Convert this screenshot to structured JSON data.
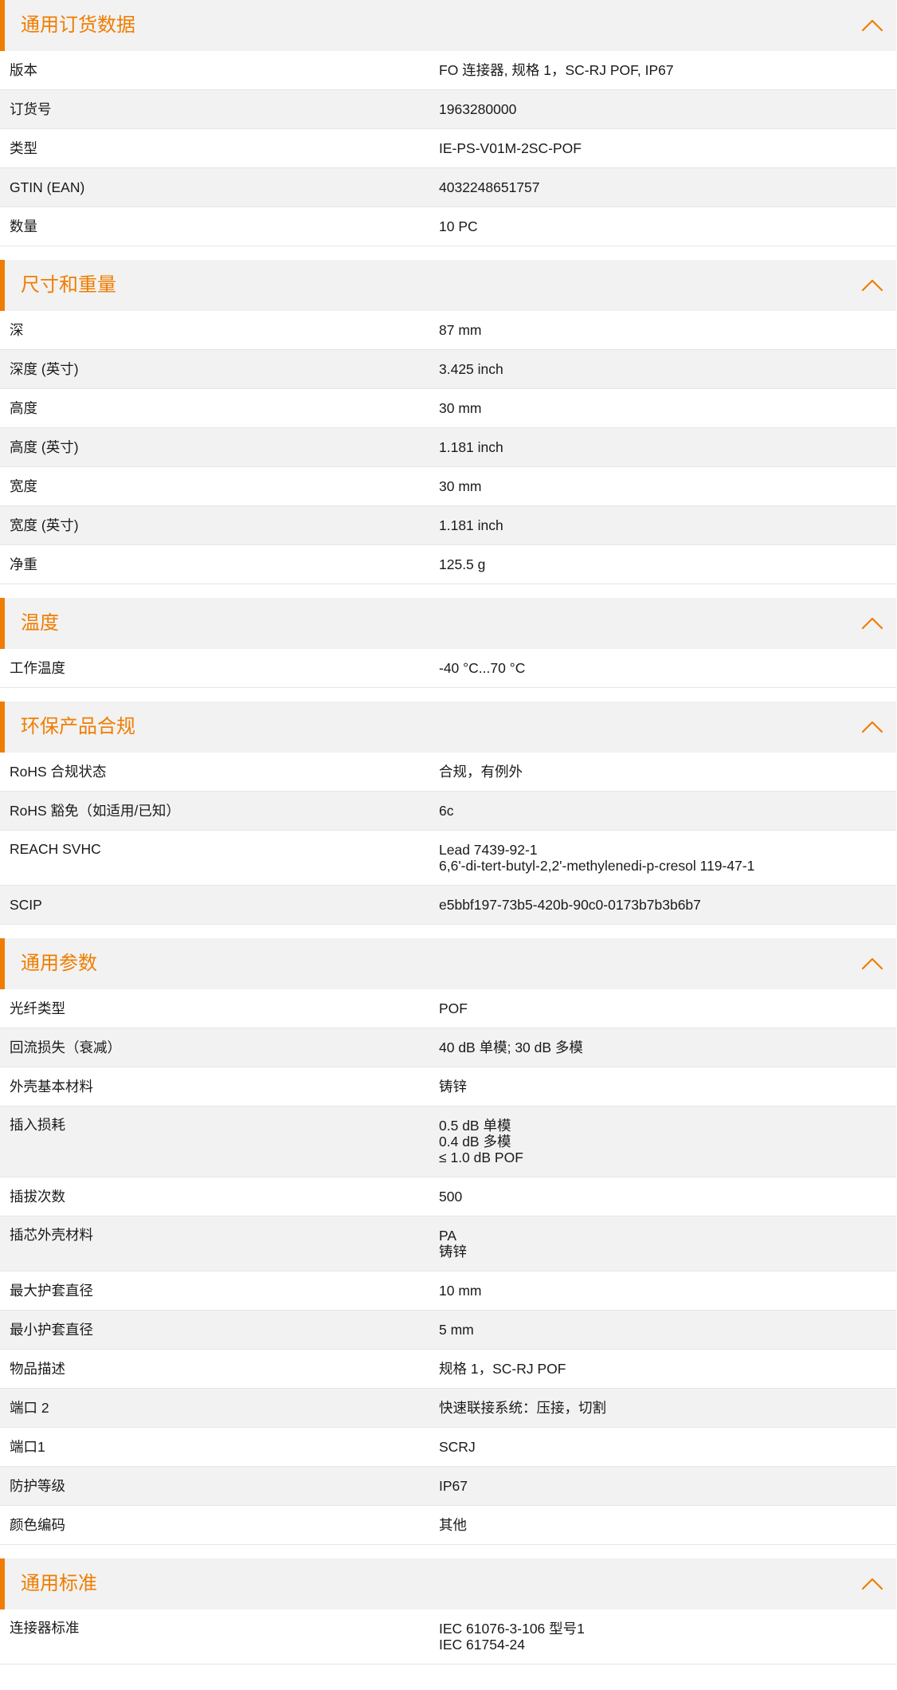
{
  "colors": {
    "accent": "#f07d00",
    "header_bg": "#f2f2f2",
    "row_shade": "#f2f2f2"
  },
  "sections": [
    {
      "title": "通用订货数据",
      "icon": "chevron-up-icon",
      "rows": [
        {
          "label": "版本",
          "values": [
            "FO 连接器, 规格 1，SC-RJ POF, IP67"
          ]
        },
        {
          "label": "订货号",
          "values": [
            "1963280000"
          ]
        },
        {
          "label": "类型",
          "values": [
            "IE-PS-V01M-2SC-POF"
          ]
        },
        {
          "label": "GTIN (EAN)",
          "values": [
            "4032248651757"
          ]
        },
        {
          "label": "数量",
          "values": [
            "10  PC"
          ]
        }
      ]
    },
    {
      "title": "尺寸和重量",
      "icon": "chevron-up-icon",
      "rows": [
        {
          "label": "深",
          "values": [
            "87  mm"
          ]
        },
        {
          "label": "深度 (英寸)",
          "values": [
            "3.425  inch"
          ]
        },
        {
          "label": "高度",
          "values": [
            "30  mm"
          ]
        },
        {
          "label": "高度 (英寸)",
          "values": [
            "1.181  inch"
          ]
        },
        {
          "label": "宽度",
          "values": [
            "30  mm"
          ]
        },
        {
          "label": "宽度 (英寸)",
          "values": [
            "1.181  inch"
          ]
        },
        {
          "label": "净重",
          "values": [
            "125.5  g"
          ]
        }
      ]
    },
    {
      "title": "温度",
      "icon": "chevron-up-icon",
      "rows": [
        {
          "label": "工作温度",
          "values": [
            "-40 °C...70 °C"
          ]
        }
      ]
    },
    {
      "title": "环保产品合规",
      "icon": "chevron-up-icon",
      "rows": [
        {
          "label": "RoHS 合规状态",
          "values": [
            "合规，有例外"
          ]
        },
        {
          "label": "RoHS 豁免（如适用/已知）",
          "values": [
            "6c"
          ]
        },
        {
          "label": "REACH SVHC",
          "values": [
            "Lead 7439-92-1",
            "6,6'-di-tert-butyl-2,2'-methylenedi-p-cresol 119-47-1"
          ]
        },
        {
          "label": "SCIP",
          "values": [
            "e5bbf197-73b5-420b-90c0-0173b7b3b6b7"
          ]
        }
      ]
    },
    {
      "title": "通用参数",
      "icon": "chevron-up-icon",
      "rows": [
        {
          "label": "光纤类型",
          "values": [
            "POF"
          ]
        },
        {
          "label": "回流损失（衰减）",
          "values": [
            "40 dB 单模; 30 dB 多模"
          ]
        },
        {
          "label": "外壳基本材料",
          "values": [
            "铸锌"
          ]
        },
        {
          "label": "插入损耗",
          "values": [
            "0.5 dB 单模",
            "0.4 dB 多模",
            "≤ 1.0 dB POF"
          ]
        },
        {
          "label": "插拔次数",
          "values": [
            "500"
          ]
        },
        {
          "label": "插芯外壳材料",
          "values": [
            "PA",
            "铸锌"
          ]
        },
        {
          "label": "最大护套直径",
          "values": [
            "10  mm"
          ]
        },
        {
          "label": "最小护套直径",
          "values": [
            "5  mm"
          ]
        },
        {
          "label": "物品描述",
          "values": [
            "规格 1，SC-RJ POF"
          ]
        },
        {
          "label": "端口 2",
          "values": [
            "快速联接系统：压接，切割"
          ]
        },
        {
          "label": "端口1",
          "values": [
            "SCRJ"
          ]
        },
        {
          "label": "防护等级",
          "values": [
            "IP67"
          ]
        },
        {
          "label": "颜色编码",
          "values": [
            "其他"
          ]
        }
      ]
    },
    {
      "title": "通用标准",
      "icon": "chevron-up-icon",
      "rows": [
        {
          "label": "连接器标准",
          "values": [
            "IEC 61076-3-106 型号1",
            "IEC 61754-24"
          ]
        }
      ]
    }
  ]
}
